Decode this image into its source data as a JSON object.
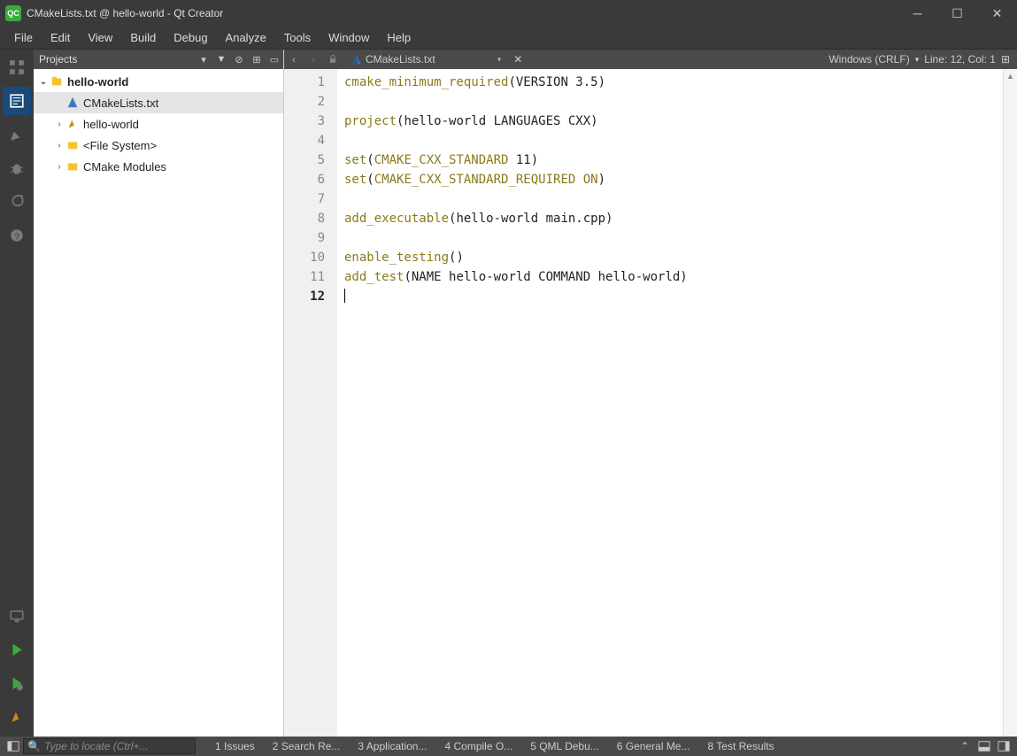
{
  "window": {
    "title": "CMakeLists.txt @ hello-world - Qt Creator",
    "app_badge": "QC"
  },
  "menu": [
    "File",
    "Edit",
    "View",
    "Build",
    "Debug",
    "Analyze",
    "Tools",
    "Window",
    "Help"
  ],
  "projects": {
    "header": "Projects",
    "tree": [
      {
        "label": "hello-world",
        "depth": 1,
        "expanded": true,
        "icon": "project",
        "bold": true
      },
      {
        "label": "CMakeLists.txt",
        "depth": 2,
        "expanded": null,
        "icon": "cmake",
        "selected": true
      },
      {
        "label": "hello-world",
        "depth": 2,
        "expanded": false,
        "icon": "target"
      },
      {
        "label": "<File System>",
        "depth": 2,
        "expanded": false,
        "icon": "folder"
      },
      {
        "label": "CMake Modules",
        "depth": 2,
        "expanded": false,
        "icon": "folder"
      }
    ]
  },
  "editor": {
    "tab": "CMakeLists.txt",
    "encoding": "Windows (CRLF)",
    "cursor": "Line: 12, Col: 1",
    "lines": [
      [
        {
          "t": "cmake_minimum_required",
          "c": "fn"
        },
        {
          "t": "(VERSION 3.5)",
          "c": ""
        }
      ],
      [],
      [
        {
          "t": "project",
          "c": "fn"
        },
        {
          "t": "(hello-world LANGUAGES CXX)",
          "c": ""
        }
      ],
      [],
      [
        {
          "t": "set",
          "c": "fn"
        },
        {
          "t": "(",
          "c": ""
        },
        {
          "t": "CMAKE_CXX_STANDARD",
          "c": "const"
        },
        {
          "t": " 11)",
          "c": ""
        }
      ],
      [
        {
          "t": "set",
          "c": "fn"
        },
        {
          "t": "(",
          "c": ""
        },
        {
          "t": "CMAKE_CXX_STANDARD_REQUIRED",
          "c": "const"
        },
        {
          "t": " ",
          "c": ""
        },
        {
          "t": "ON",
          "c": "onkw"
        },
        {
          "t": ")",
          "c": ""
        }
      ],
      [],
      [
        {
          "t": "add_executable",
          "c": "fn"
        },
        {
          "t": "(hello-world main.cpp)",
          "c": ""
        }
      ],
      [],
      [
        {
          "t": "enable_testing",
          "c": "fn"
        },
        {
          "t": "()",
          "c": ""
        }
      ],
      [
        {
          "t": "add_test",
          "c": "fn"
        },
        {
          "t": "(NAME hello-world COMMAND hello-world)",
          "c": ""
        }
      ],
      []
    ],
    "current_line": 12
  },
  "status": {
    "locator_placeholder": "Type to locate (Ctrl+...",
    "tabs": [
      {
        "num": "1",
        "label": "Issues"
      },
      {
        "num": "2",
        "label": "Search Re..."
      },
      {
        "num": "3",
        "label": "Application..."
      },
      {
        "num": "4",
        "label": "Compile O..."
      },
      {
        "num": "5",
        "label": "QML Debu..."
      },
      {
        "num": "6",
        "label": "General Me..."
      },
      {
        "num": "8",
        "label": "Test Results"
      }
    ]
  }
}
